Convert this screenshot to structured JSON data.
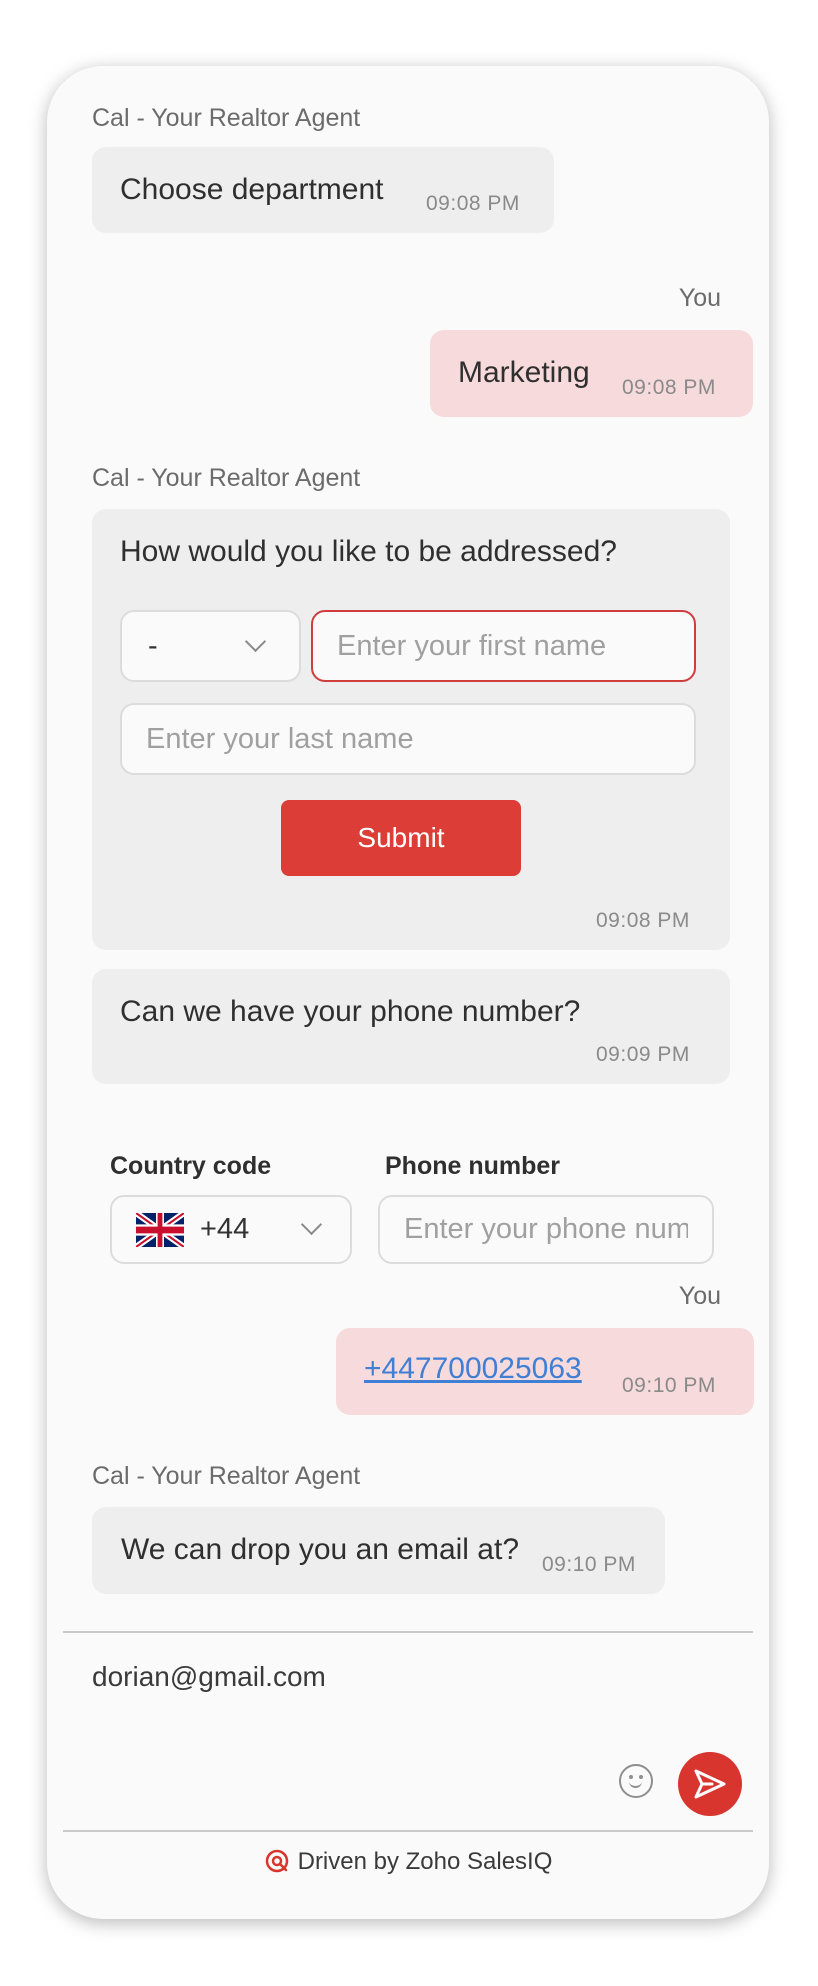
{
  "agent_name": "Cal - Your Realtor Agent",
  "you_label": "You",
  "messages": {
    "m1": {
      "text": "Choose department",
      "time": "09:08 PM"
    },
    "m2": {
      "text": "Marketing",
      "time": "09:08 PM"
    },
    "m3": {
      "text": "How would you like to be addressed?",
      "salutation": "-",
      "first_name_placeholder": "Enter your first name",
      "last_name_placeholder": "Enter your last name",
      "submit_label": "Submit",
      "time": "09:08 PM"
    },
    "m4": {
      "text": "Can we have your phone number?",
      "time": "09:09 PM"
    },
    "phone_form": {
      "country_code_label": "Country code",
      "phone_label": "Phone number",
      "country_code_value": "+44",
      "phone_placeholder": "Enter your phone number"
    },
    "m5": {
      "text": "+447700025063",
      "time": "09:10 PM"
    },
    "m6": {
      "text": "We can drop you an email at?",
      "time": "09:10 PM"
    }
  },
  "composer": {
    "value": "dorian@gmail.com"
  },
  "footer": {
    "text": "Driven by Zoho SalesIQ"
  },
  "colors": {
    "accent": "#dc3d36",
    "user_bubble": "#f7dadb",
    "agent_bubble": "#eeeeee",
    "link": "#3f7fd4"
  },
  "icons": {
    "emoji": "smiley-icon",
    "send": "send-icon",
    "flag": "uk-flag-icon",
    "brand": "salesiq-logo-icon"
  }
}
